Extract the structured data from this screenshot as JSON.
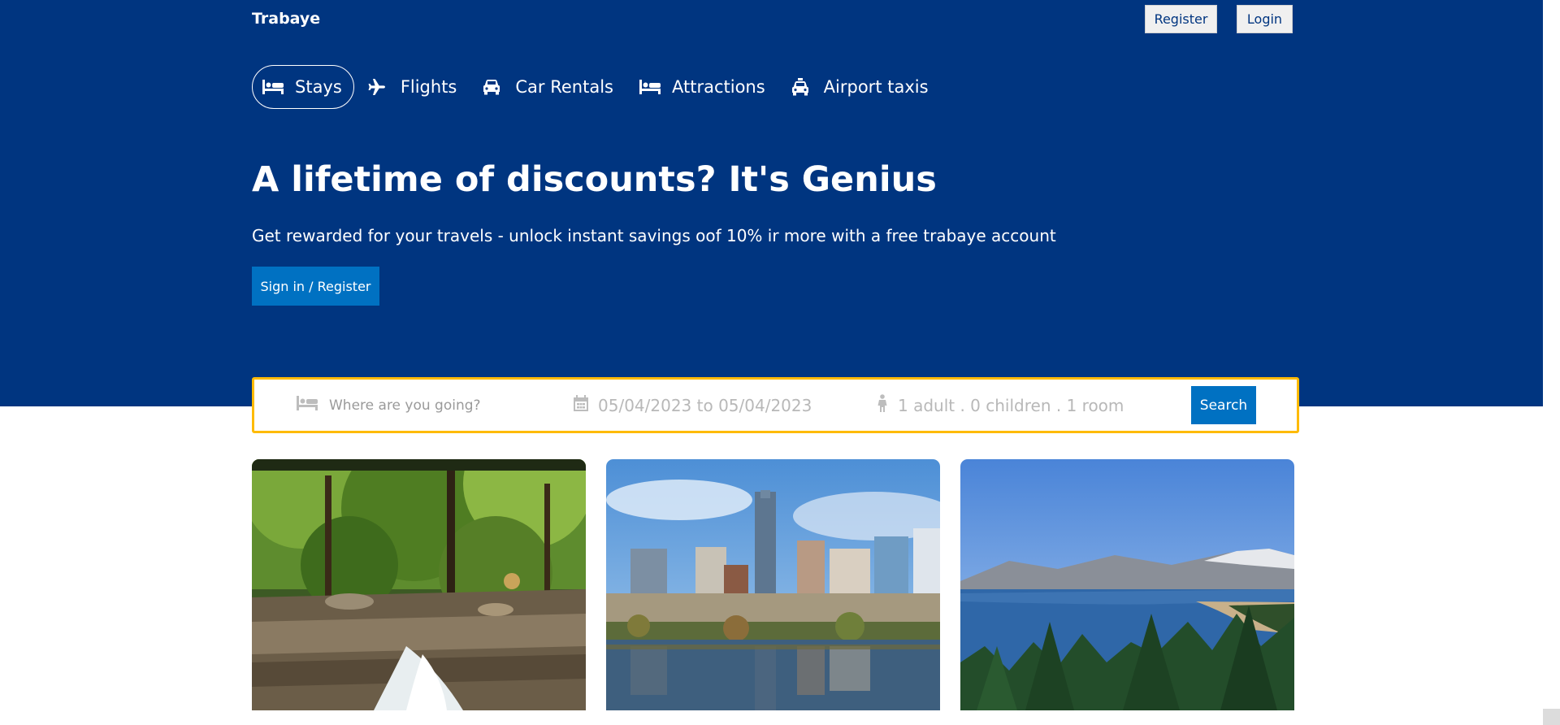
{
  "header": {
    "brand": "Trabaye",
    "register_label": "Register",
    "login_label": "Login"
  },
  "nav": {
    "items": [
      {
        "label": "Stays",
        "icon": "bed-icon",
        "active": true
      },
      {
        "label": "Flights",
        "icon": "plane-icon",
        "active": false
      },
      {
        "label": "Car Rentals",
        "icon": "car-icon",
        "active": false
      },
      {
        "label": "Attractions",
        "icon": "bed-icon",
        "active": false
      },
      {
        "label": "Airport taxis",
        "icon": "taxi-icon",
        "active": false
      }
    ]
  },
  "hero": {
    "title": "A lifetime of discounts? It's Genius",
    "subtitle": "Get rewarded for your travels - unlock instant savings oof 10% ir more with a free trabaye account",
    "signin_label": "Sign in / Register"
  },
  "search": {
    "destination_placeholder": "Where are you going?",
    "dates": "05/04/2023 to 05/04/2023",
    "guests": "1 adult . 0 children . 1 room",
    "search_label": "Search"
  },
  "cards": [
    {
      "image": "forest-waterfall-photo"
    },
    {
      "image": "city-skyline-lake-photo"
    },
    {
      "image": "mountain-lake-pines-photo"
    }
  ],
  "colors": {
    "hero_bg": "#003580",
    "accent_button": "#0071c2",
    "searchbar_border": "#febb02"
  }
}
